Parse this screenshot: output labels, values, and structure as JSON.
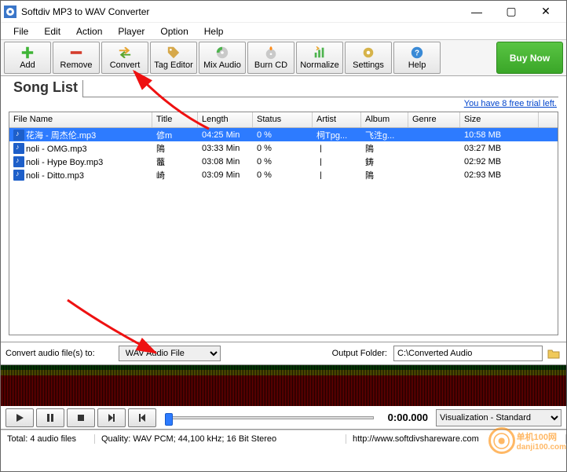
{
  "window": {
    "title": "Softdiv MP3 to WAV Converter"
  },
  "menu": {
    "file": "File",
    "edit": "Edit",
    "action": "Action",
    "player": "Player",
    "option": "Option",
    "help": "Help"
  },
  "tb": {
    "add": "Add",
    "remove": "Remove",
    "convert": "Convert",
    "tag": "Tag Editor",
    "mix": "Mix Audio",
    "burn": "Burn CD",
    "norm": "Normalize",
    "settings": "Settings",
    "help": "Help",
    "buy": "Buy Now"
  },
  "list": {
    "heading": "Song List",
    "trial": "You have 8 free trial left.",
    "headers": {
      "fn": "File Name",
      "ti": "Title",
      "ln": "Length",
      "st": "Status",
      "ar": "Artist",
      "al": "Album",
      "ge": "Genre",
      "sz": "Size"
    },
    "rows": [
      {
        "fn": "花海 - 周杰伦.mp3",
        "ti": "偐m",
        "ln": "04:25 Min",
        "st": "0 %",
        "ar": "柌Tpg...",
        "al": "飞泩g...",
        "ge": "",
        "sz": "10:58 MB",
        "sel": true
      },
      {
        "fn": "noli - OMG.mp3",
        "ti": "隝",
        "ln": "03:33 Min",
        "st": "0 %",
        "ar": "〡",
        "al": "隝",
        "ge": "",
        "sz": "03:27 MB",
        "sel": false
      },
      {
        "fn": "noli - Hype Boy.mp3",
        "ti": "虌",
        "ln": "03:08 Min",
        "st": "0 %",
        "ar": "〡",
        "al": "鋳",
        "ge": "",
        "sz": "02:92 MB",
        "sel": false
      },
      {
        "fn": "noli - Ditto.mp3",
        "ti": "崎",
        "ln": "03:09 Min",
        "st": "0 %",
        "ar": "〡",
        "al": "隝",
        "ge": "",
        "sz": "02:93 MB",
        "sel": false
      }
    ]
  },
  "conv": {
    "label": "Convert audio file(s) to:",
    "format": "WAV Audio File",
    "outlabel": "Output Folder:",
    "outpath": "C:\\Converted Audio"
  },
  "player": {
    "time": "0:00.000",
    "vis": "Visualization - Standard"
  },
  "status": {
    "total": "Total: 4 audio files",
    "quality": "Quality: WAV PCM; 44,100 kHz; 16 Bit Stereo",
    "url": "http://www.softdivshareware.com"
  },
  "watermark": {
    "t1": "单机100网",
    "t2": "danji100.com"
  }
}
